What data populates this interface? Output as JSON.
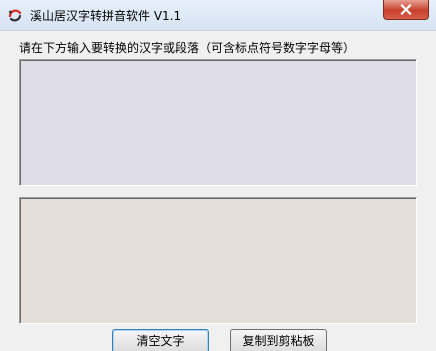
{
  "window": {
    "title": "溪山居汉字转拼音软件 V1.1",
    "icon": "app-logo-icon",
    "close_icon": "close-icon",
    "close_color": "#c7402a"
  },
  "main": {
    "prompt": "请在下方输入要转换的汉字或段落（可含标点符号数字字母等）",
    "input": {
      "value": "",
      "placeholder": "",
      "background": "#dfdde7"
    },
    "output": {
      "value": "",
      "background": "#e6dedb"
    }
  },
  "buttons": {
    "clear_label": "清空文字",
    "copy_label": "复制到剪粘板"
  }
}
